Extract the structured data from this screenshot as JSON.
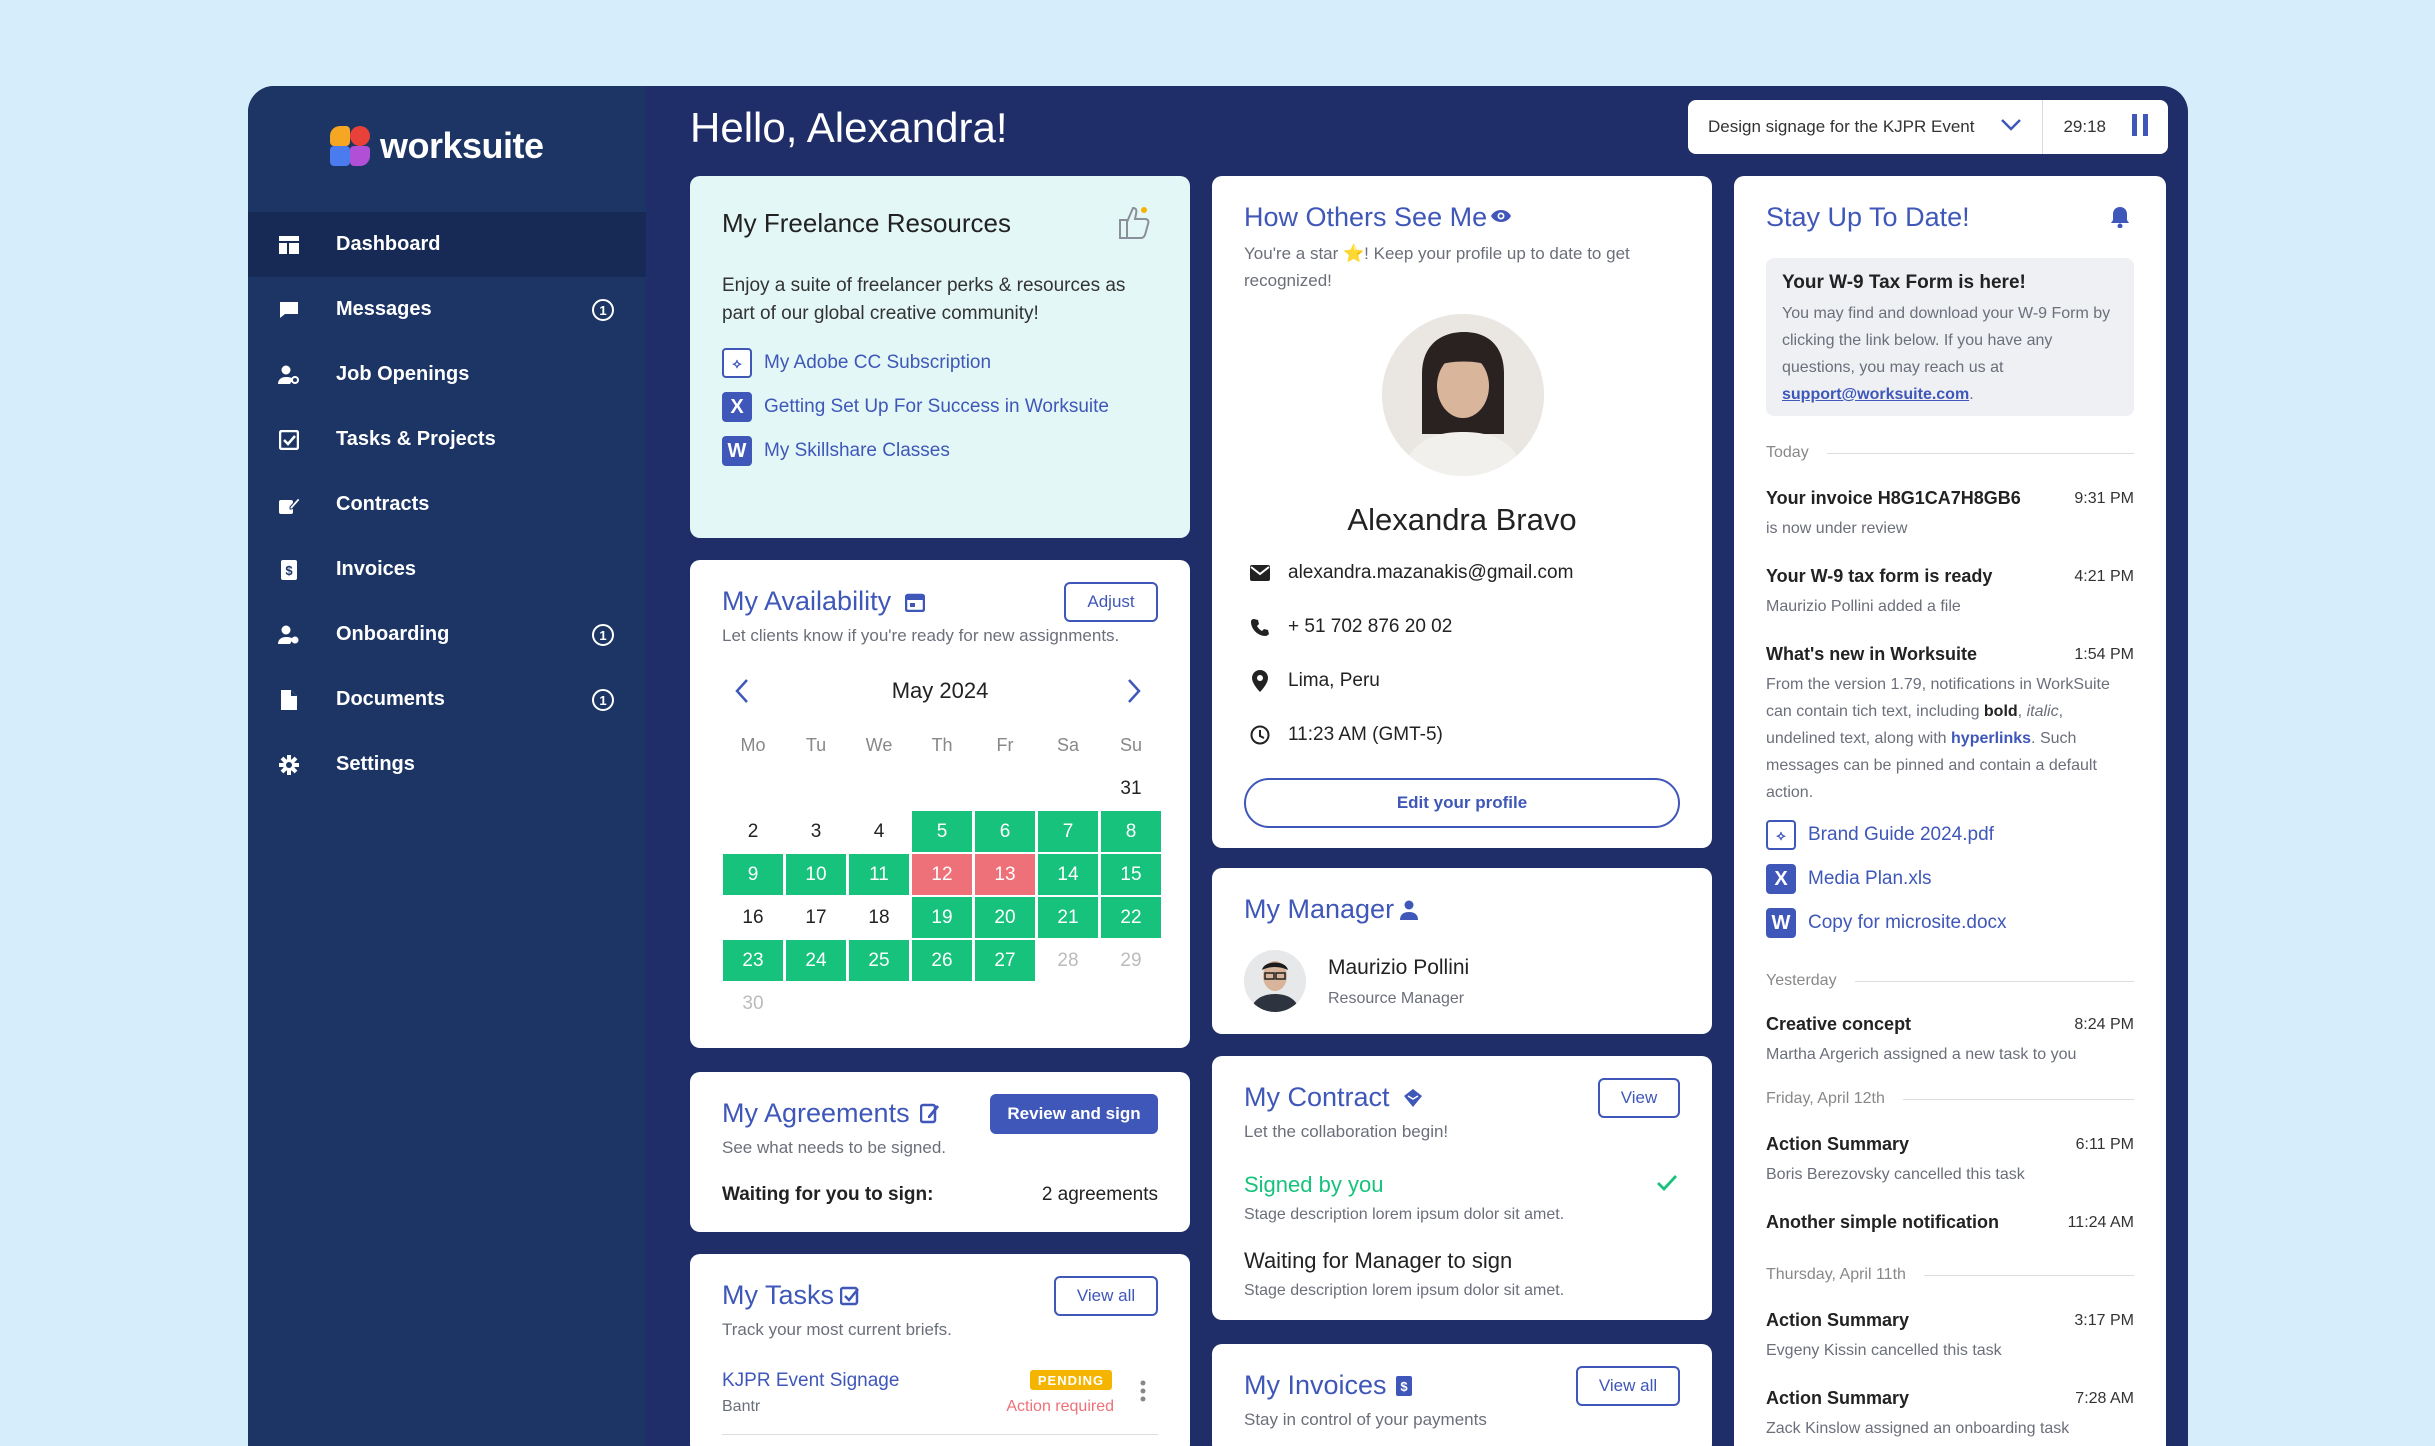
{
  "brand": {
    "name": "worksuite"
  },
  "greeting": "Hello,  Alexandra!",
  "timer": {
    "task": "Design signage for the KJPR Event",
    "time": "29:18"
  },
  "nav": [
    {
      "label": "Dashboard",
      "icon": "dashboard-icon",
      "badge": "",
      "active": true
    },
    {
      "label": "Messages",
      "icon": "chat-icon",
      "badge": "1"
    },
    {
      "label": "Job Openings",
      "icon": "person-search-icon",
      "badge": ""
    },
    {
      "label": "Tasks & Projects",
      "icon": "checkbox-icon",
      "badge": ""
    },
    {
      "label": "Contracts",
      "icon": "contract-icon",
      "badge": ""
    },
    {
      "label": "Invoices",
      "icon": "invoice-icon",
      "badge": ""
    },
    {
      "label": "Onboarding",
      "icon": "person-settings-icon",
      "badge": "1"
    },
    {
      "label": "Documents",
      "icon": "document-icon",
      "badge": "1"
    },
    {
      "label": "Settings",
      "icon": "gear-icon",
      "badge": ""
    }
  ],
  "resources": {
    "title": "My Freelance Resources",
    "desc": "Enjoy a suite of freelancer perks & resources as part of our global creative community!",
    "links": [
      {
        "icon": "pdf-icon",
        "label": "My Adobe CC Subscription"
      },
      {
        "icon": "excel-icon",
        "label": "Getting Set Up For Success in Worksuite"
      },
      {
        "icon": "word-icon",
        "label": "My Skillshare Classes"
      }
    ]
  },
  "availability": {
    "title": "My Availability",
    "sub": "Let clients know if you're ready for new assignments.",
    "adjust": "Adjust",
    "month": "May 2024",
    "weekdays": [
      "Mo",
      "Tu",
      "We",
      "Th",
      "Fr",
      "Sa",
      "Su"
    ],
    "days": [
      {
        "d": "",
        "s": ""
      },
      {
        "d": "",
        "s": ""
      },
      {
        "d": "",
        "s": ""
      },
      {
        "d": "",
        "s": ""
      },
      {
        "d": "",
        "s": ""
      },
      {
        "d": "",
        "s": ""
      },
      {
        "d": "31",
        "s": ""
      },
      {
        "d": "2",
        "s": ""
      },
      {
        "d": "3",
        "s": ""
      },
      {
        "d": "4",
        "s": ""
      },
      {
        "d": "5",
        "s": "av"
      },
      {
        "d": "6",
        "s": "av"
      },
      {
        "d": "7",
        "s": "av"
      },
      {
        "d": "8",
        "s": "av"
      },
      {
        "d": "9",
        "s": "av"
      },
      {
        "d": "10",
        "s": "av"
      },
      {
        "d": "11",
        "s": "av"
      },
      {
        "d": "12",
        "s": "bk"
      },
      {
        "d": "13",
        "s": "bk"
      },
      {
        "d": "14",
        "s": "av"
      },
      {
        "d": "15",
        "s": "av"
      },
      {
        "d": "16",
        "s": ""
      },
      {
        "d": "17",
        "s": ""
      },
      {
        "d": "18",
        "s": ""
      },
      {
        "d": "19",
        "s": "av"
      },
      {
        "d": "20",
        "s": "av"
      },
      {
        "d": "21",
        "s": "av"
      },
      {
        "d": "22",
        "s": "av"
      },
      {
        "d": "23",
        "s": "av"
      },
      {
        "d": "24",
        "s": "av"
      },
      {
        "d": "25",
        "s": "av"
      },
      {
        "d": "26",
        "s": "av"
      },
      {
        "d": "27",
        "s": "av"
      },
      {
        "d": "28",
        "s": "mute"
      },
      {
        "d": "29",
        "s": "mute"
      },
      {
        "d": "30",
        "s": "mute"
      }
    ]
  },
  "agreements": {
    "title": "My Agreements",
    "sub": "See what needs to be signed.",
    "button": "Review and sign",
    "waiting_label": "Waiting for you to sign:",
    "waiting_value": "2 agreements"
  },
  "tasks": {
    "title": "My Tasks",
    "sub": "Track your most current briefs.",
    "button": "View all",
    "items": [
      {
        "name": "KJPR Event Signage",
        "client": "Bantr",
        "status": "PENDING",
        "action": "Action required"
      }
    ]
  },
  "profile": {
    "title": "How Others See Me",
    "sub": "You're a star ⭐! Keep your profile up to date to get recognized!",
    "name": "Alexandra Bravo",
    "email": "alexandra.mazanakis@gmail.com",
    "phone": "+ 51 702 876 20 02",
    "location": "Lima, Peru",
    "time": "11:23 AM (GMT-5)",
    "button": "Edit your profile"
  },
  "manager": {
    "title": "My Manager",
    "name": "Maurizio Pollini",
    "role": "Resource Manager"
  },
  "contract": {
    "title": "My Contract",
    "sub": "Let the collaboration begin!",
    "button": "View",
    "stages": [
      {
        "label": "Signed by you",
        "desc": "Stage description lorem ipsum dolor sit amet."
      },
      {
        "label": "Waiting for Manager to sign",
        "desc": "Stage description lorem ipsum dolor sit amet."
      }
    ]
  },
  "invoices": {
    "title": "My Invoices",
    "sub": "Stay in control of your payments",
    "button": "View all"
  },
  "updates": {
    "title": "Stay Up To Date!",
    "banner": {
      "title": "Your W-9 Tax Form is here!",
      "text": "You may find and download your W-9 Form by clicking the link below. If you have any questions, you may reach us at",
      "email": "support@worksuite.com",
      "end": "."
    },
    "groups": [
      {
        "day": "Today"
      },
      {
        "day": "Yesterday"
      },
      {
        "day": "Friday, April 12th"
      },
      {
        "day": "Thursday, April 11th"
      }
    ],
    "items": [
      {
        "title": "Your invoice H8G1CA7H8GB6",
        "time": "9:31 PM",
        "desc": "is now under review"
      },
      {
        "title": "Your W-9 tax form is ready",
        "time": "4:21 PM",
        "desc": "Maurizio Pollini added a file"
      },
      {
        "title": "What's new in Worksuite",
        "time": "1:54 PM",
        "desc_a": "From the version 1.79, notifications in WorkSuite can contain tich text, including ",
        "bold": "bold",
        "sep1": ", ",
        "italic": "italic",
        "sep2": ",",
        "desc_b": " undelined text, along with ",
        "hyper": "hyperlinks",
        "desc_c": ". Such messages can be pinned and contain a default action."
      },
      {
        "title": "Creative concept",
        "time": "8:24 PM",
        "desc": "Martha Argerich assigned a new task to you"
      },
      {
        "title": "Action Summary",
        "time": "6:11 PM",
        "desc": "Boris Berezovsky cancelled this task"
      },
      {
        "title": "Another simple notification",
        "time": "11:24 AM",
        "desc": ""
      },
      {
        "title": "Action Summary",
        "time": "3:17 PM",
        "desc": "Evgeny Kissin cancelled this task"
      },
      {
        "title": "Action Summary",
        "time": "7:28 AM",
        "desc": "Zack Kinslow assigned an onboarding task"
      }
    ],
    "files": [
      {
        "icon": "pdf-icon",
        "label": "Brand Guide 2024.pdf"
      },
      {
        "icon": "excel-icon",
        "label": "Media Plan.xls"
      },
      {
        "icon": "word-icon",
        "label": "Copy for microsite.docx"
      }
    ]
  },
  "colors": {
    "primary": "#3f57b8",
    "sidebar": "#1c3564",
    "frame": "#1f2d68",
    "available": "#17c37c",
    "booked": "#ee7179",
    "pending": "#f5b400"
  }
}
